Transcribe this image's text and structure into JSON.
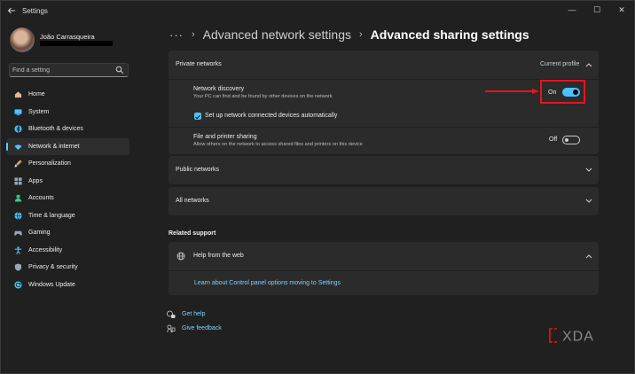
{
  "window": {
    "title": "Settings",
    "controls": [
      "—",
      "☐",
      "✕"
    ]
  },
  "user": {
    "name": "João Carrasqueira"
  },
  "search": {
    "placeholder": "Find a setting"
  },
  "nav": [
    {
      "id": "home",
      "label": "Home",
      "icon": "home-icon",
      "color": "#e8b48c"
    },
    {
      "id": "system",
      "label": "System",
      "icon": "system-icon",
      "color": "#4cc2ff"
    },
    {
      "id": "bluetooth",
      "label": "Bluetooth & devices",
      "icon": "bluetooth-icon",
      "color": "#4cc2ff"
    },
    {
      "id": "network",
      "label": "Network & internet",
      "icon": "wifi-icon",
      "color": "#4cc2ff",
      "active": true
    },
    {
      "id": "personalization",
      "label": "Personalization",
      "icon": "brush-icon",
      "color": "#e8a060"
    },
    {
      "id": "apps",
      "label": "Apps",
      "icon": "apps-icon",
      "color": "#9aa6b8"
    },
    {
      "id": "accounts",
      "label": "Accounts",
      "icon": "accounts-icon",
      "color": "#38c98f"
    },
    {
      "id": "time",
      "label": "Time & language",
      "icon": "globe-icon",
      "color": "#4cc2ff"
    },
    {
      "id": "gaming",
      "label": "Gaming",
      "icon": "gaming-icon",
      "color": "#9aa6b8"
    },
    {
      "id": "accessibility",
      "label": "Accessibility",
      "icon": "accessibility-icon",
      "color": "#4cc2ff"
    },
    {
      "id": "privacy",
      "label": "Privacy & security",
      "icon": "shield-icon",
      "color": "#9aa6b8"
    },
    {
      "id": "update",
      "label": "Windows Update",
      "icon": "update-icon",
      "color": "#4cc2ff"
    }
  ],
  "breadcrumb": {
    "more": "···",
    "parent": "Advanced network settings",
    "current": "Advanced sharing settings"
  },
  "private": {
    "title": "Private networks",
    "badge": "Current profile",
    "discovery": {
      "label": "Network discovery",
      "desc": "Your PC can find and be found by other devices on the network",
      "state": "On"
    },
    "auto_setup": {
      "label": "Set up network connected devices automatically",
      "checked": true
    },
    "sharing": {
      "label": "File and printer sharing",
      "desc": "Allow others on the network to access shared files and printers on this device",
      "state": "Off"
    }
  },
  "public": {
    "title": "Public networks"
  },
  "all": {
    "title": "All networks"
  },
  "related": {
    "title": "Related support",
    "help_title": "Help from the web",
    "link": "Learn about Control panel options moving to Settings"
  },
  "footer": {
    "get_help": "Get help",
    "feedback": "Give feedback"
  },
  "watermark": {
    "text": "XDA"
  },
  "colors": {
    "accent": "#4cc2ff",
    "highlight": "#e8141c"
  }
}
